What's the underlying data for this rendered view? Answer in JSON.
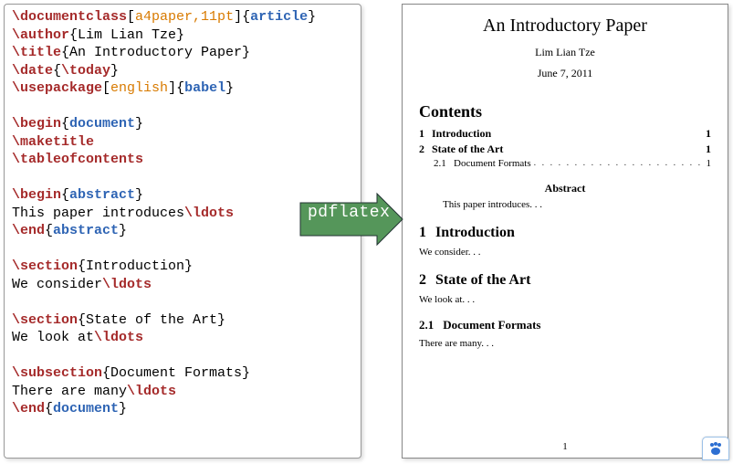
{
  "code": {
    "lines": [
      {
        "tokens": [
          {
            "c": "cmd",
            "t": "\\documentclass"
          },
          {
            "c": "br",
            "t": "["
          },
          {
            "c": "opt",
            "t": "a4paper,11pt"
          },
          {
            "c": "br",
            "t": "]{"
          },
          {
            "c": "arg",
            "t": "article"
          },
          {
            "c": "br",
            "t": "}"
          }
        ]
      },
      {
        "tokens": [
          {
            "c": "cmd",
            "t": "\\author"
          },
          {
            "c": "br",
            "t": "{Lim Lian Tze}"
          }
        ]
      },
      {
        "tokens": [
          {
            "c": "cmd",
            "t": "\\title"
          },
          {
            "c": "br",
            "t": "{An Introductory Paper}"
          }
        ]
      },
      {
        "tokens": [
          {
            "c": "cmd",
            "t": "\\date"
          },
          {
            "c": "br",
            "t": "{"
          },
          {
            "c": "cmd",
            "t": "\\today"
          },
          {
            "c": "br",
            "t": "}"
          }
        ]
      },
      {
        "tokens": [
          {
            "c": "cmd",
            "t": "\\usepackage"
          },
          {
            "c": "br",
            "t": "["
          },
          {
            "c": "opt",
            "t": "english"
          },
          {
            "c": "br",
            "t": "]{"
          },
          {
            "c": "arg",
            "t": "babel"
          },
          {
            "c": "br",
            "t": "}"
          }
        ]
      },
      {
        "tokens": [
          {
            "c": "br",
            "t": " "
          }
        ]
      },
      {
        "tokens": [
          {
            "c": "cmd",
            "t": "\\begin"
          },
          {
            "c": "br",
            "t": "{"
          },
          {
            "c": "arg",
            "t": "document"
          },
          {
            "c": "br",
            "t": "}"
          }
        ]
      },
      {
        "tokens": [
          {
            "c": "cmd",
            "t": "\\maketitle"
          }
        ]
      },
      {
        "tokens": [
          {
            "c": "cmd",
            "t": "\\tableofcontents"
          }
        ]
      },
      {
        "tokens": [
          {
            "c": "br",
            "t": " "
          }
        ]
      },
      {
        "tokens": [
          {
            "c": "cmd",
            "t": "\\begin"
          },
          {
            "c": "br",
            "t": "{"
          },
          {
            "c": "arg",
            "t": "abstract"
          },
          {
            "c": "br",
            "t": "}"
          }
        ]
      },
      {
        "tokens": [
          {
            "c": "br",
            "t": "This paper introduces"
          },
          {
            "c": "cmd",
            "t": "\\ldots"
          }
        ]
      },
      {
        "tokens": [
          {
            "c": "cmd",
            "t": "\\end"
          },
          {
            "c": "br",
            "t": "{"
          },
          {
            "c": "arg",
            "t": "abstract"
          },
          {
            "c": "br",
            "t": "}"
          }
        ]
      },
      {
        "tokens": [
          {
            "c": "br",
            "t": " "
          }
        ]
      },
      {
        "tokens": [
          {
            "c": "cmd",
            "t": "\\section"
          },
          {
            "c": "br",
            "t": "{Introduction}"
          }
        ]
      },
      {
        "tokens": [
          {
            "c": "br",
            "t": "We consider"
          },
          {
            "c": "cmd",
            "t": "\\ldots"
          }
        ]
      },
      {
        "tokens": [
          {
            "c": "br",
            "t": " "
          }
        ]
      },
      {
        "tokens": [
          {
            "c": "cmd",
            "t": "\\section"
          },
          {
            "c": "br",
            "t": "{State of the Art}"
          }
        ]
      },
      {
        "tokens": [
          {
            "c": "br",
            "t": "We look at"
          },
          {
            "c": "cmd",
            "t": "\\ldots"
          }
        ]
      },
      {
        "tokens": [
          {
            "c": "br",
            "t": " "
          }
        ]
      },
      {
        "tokens": [
          {
            "c": "cmd",
            "t": "\\subsection"
          },
          {
            "c": "br",
            "t": "{Document Formats}"
          }
        ]
      },
      {
        "tokens": [
          {
            "c": "br",
            "t": "There are many"
          },
          {
            "c": "cmd",
            "t": "\\ldots"
          }
        ]
      },
      {
        "tokens": [
          {
            "c": "cmd",
            "t": "\\end"
          },
          {
            "c": "br",
            "t": "{"
          },
          {
            "c": "arg",
            "t": "document"
          },
          {
            "c": "br",
            "t": "}"
          }
        ]
      }
    ]
  },
  "arrow_label": "pdflatex",
  "render": {
    "title": "An Introductory Paper",
    "author": "Lim Lian Tze",
    "date": "June 7, 2011",
    "contents_heading": "Contents",
    "toc": [
      {
        "type": "sec",
        "num": "1",
        "label": "Introduction",
        "page": "1"
      },
      {
        "type": "sec",
        "num": "2",
        "label": "State of the Art",
        "page": "1"
      },
      {
        "type": "sub",
        "num": "2.1",
        "label": "Document Formats",
        "page": "1"
      }
    ],
    "abstract_heading": "Abstract",
    "abstract_body": "This paper introduces. . .",
    "sections": [
      {
        "num": "1",
        "title": "Introduction",
        "body": "We consider. . ."
      },
      {
        "num": "2",
        "title": "State of the Art",
        "body": "We look at. . ."
      }
    ],
    "subsections": [
      {
        "num": "2.1",
        "title": "Document Formats",
        "body": "There are many. . ."
      }
    ],
    "page_number": "1"
  }
}
